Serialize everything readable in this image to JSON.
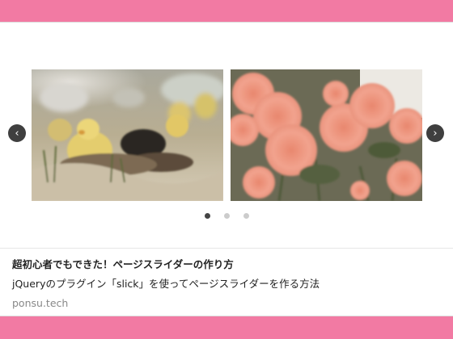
{
  "card": {
    "title": "超初心者でもできた！ページスライダーの作り方",
    "description": "jQueryのプラグイン「slick」を使ってページスライダーを作る方法",
    "domain": "ponsu.tech"
  },
  "slider": {
    "prev_icon": "chevron-left-icon",
    "next_icon": "chevron-right-icon",
    "prev_glyph": "‹",
    "next_glyph": "›",
    "dots": 3,
    "active_dot": 1,
    "slides": [
      {
        "subject": "ducklings"
      },
      {
        "subject": "pink dahlias"
      }
    ]
  },
  "colors": {
    "page_background": "#f27aa3",
    "card_background": "#ffffff",
    "arrow_background": "#3f3f3f",
    "active_dot": "#444444",
    "inactive_dot": "#cccccc"
  }
}
